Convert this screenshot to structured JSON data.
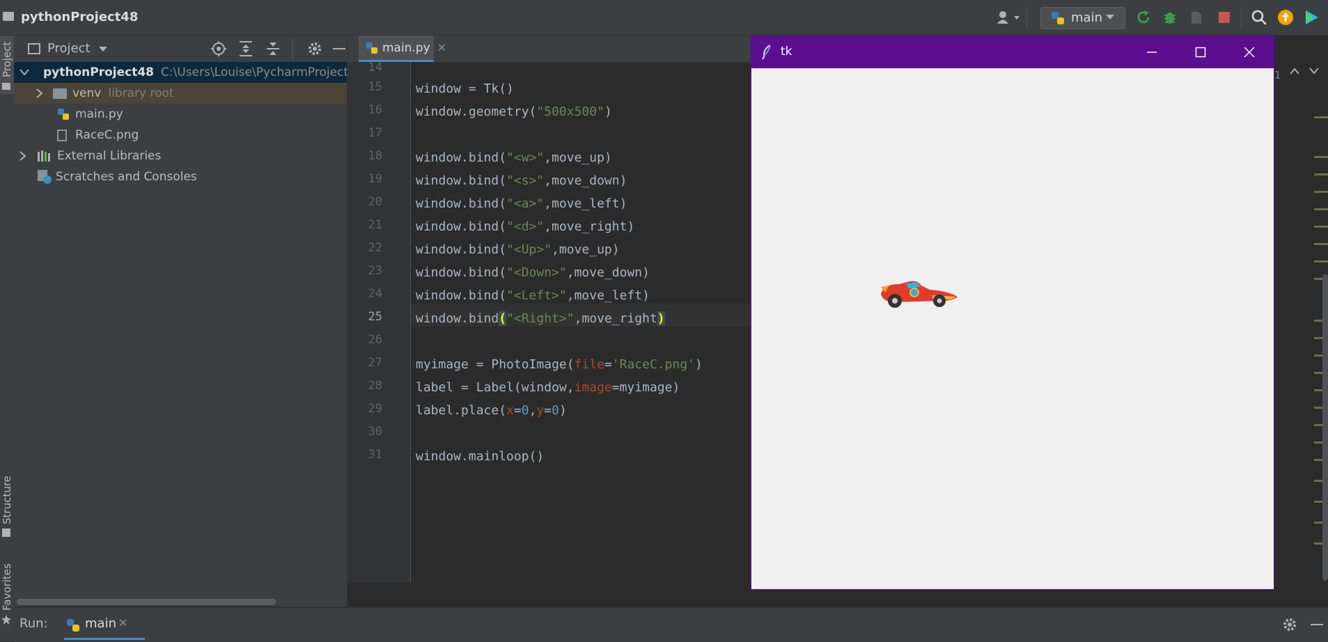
{
  "ide": {
    "project_name": "pythonProject48",
    "run_config": "main",
    "colors": {
      "accent_purple": "#5b0f8f",
      "run_green": "#3c9a4f",
      "stop_red": "#c75450",
      "update_orange": "#f0a30a"
    }
  },
  "left_strip": {
    "project": "Project",
    "structure": "Structure",
    "favorites": "Favorites"
  },
  "project_panel": {
    "title": "Project",
    "tree": {
      "root": {
        "name": "pythonProject48",
        "path": "C:\\Users\\Louise\\PycharmProjects\\"
      },
      "venv": {
        "name": "venv",
        "hint": "library root"
      },
      "main_py": "main.py",
      "racec_png": "RaceC.png",
      "external_libraries": "External Libraries",
      "scratches": "Scratches and Consoles"
    }
  },
  "editor": {
    "tab": "main.py",
    "line_numbers": [
      "14",
      "15",
      "16",
      "17",
      "18",
      "19",
      "20",
      "21",
      "22",
      "23",
      "24",
      "25",
      "26",
      "27",
      "28",
      "29",
      "30",
      "31"
    ],
    "current_line": "25",
    "right_counter": "1"
  },
  "run_panel": {
    "label": "Run:",
    "tab": "main"
  },
  "tk_window": {
    "title": "tk"
  }
}
